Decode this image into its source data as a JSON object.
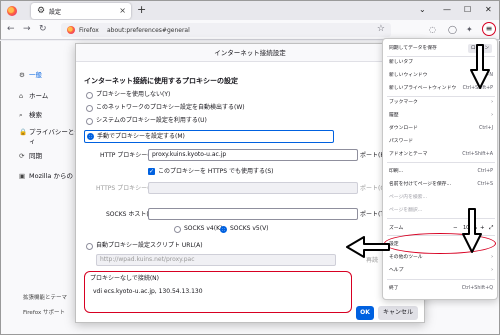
{
  "tab": {
    "title": "設定"
  },
  "urlbar": {
    "brand": "Firefox",
    "url": "about:preferences#general"
  },
  "sidebar": {
    "items": [
      {
        "icon": "gear-icon",
        "label": "一般"
      },
      {
        "icon": "home-icon",
        "label": "ホーム"
      },
      {
        "icon": "search-icon",
        "label": "検索"
      },
      {
        "icon": "lock-icon",
        "label": "プライバシーとセ"
      },
      {
        "icon": "lock-icon",
        "label": "ィ"
      },
      {
        "icon": "sync-icon",
        "label": "同期"
      },
      {
        "icon": "mozilla-icon",
        "label": "Mozilla からの"
      }
    ],
    "footer": [
      "拡張機能とテーマ",
      "Firefox サポート"
    ]
  },
  "dialog": {
    "title": "インターネット接続設定",
    "heading": "インターネット接続に使用するプロキシーの設定",
    "options": [
      "プロキシーを使用しない(Y)",
      "このネットワークのプロキシー設定を自動検出する(W)",
      "システムのプロキシー設定を利用する(U)",
      "手動でプロキシーを設定する(M)"
    ],
    "http_label": "HTTP プロキシー(X)",
    "http_value": "proxy.kuins.kyoto-u.ac.jp",
    "port_label": "ポート(P)",
    "https_check": "このプロキシーを HTTPS でも使用する(S)",
    "https_label": "HTTPS プロキシー(H)",
    "https_port_label": "ポート(O)",
    "socks_label": "SOCKS ホスト(C)",
    "socks_port_label": "ポート(T)",
    "socks_v4": "SOCKS v4(K)",
    "socks_v5": "SOCKS v5(V)",
    "pac_label": "自動プロキシー設定スクリプト URL(A)",
    "pac_value": "http://wpad.kuins.net/proxy.pac",
    "pac_button": "再読",
    "noproxy_label": "プロキシーなしで接続(N)",
    "noproxy_value": "vdi ecs.kyoto-u.ac.jp, 130.54.13.130",
    "ok": "OK",
    "cancel": "キャンセル"
  },
  "menu": {
    "sync_row": "同期してデータを保存",
    "sync_button": "ログイン",
    "items": [
      {
        "label": "新しいタブ",
        "shortcut": ""
      },
      {
        "label": "新しいウィンドウ",
        "shortcut": "Ctrl+N"
      },
      {
        "label": "新しいプライベートウィンドウ",
        "shortcut": "Ctrl+Shift+P"
      },
      {
        "label": "ブックマーク",
        "shortcut": ""
      },
      {
        "label": "履歴",
        "shortcut": ""
      },
      {
        "label": "ダウンロード",
        "shortcut": "Ctrl+J"
      },
      {
        "label": "パスワード",
        "shortcut": ""
      },
      {
        "label": "アドオンとテーマ",
        "shortcut": "Ctrl+Shift+A"
      },
      {
        "label": "印刷...",
        "shortcut": "Ctrl+P"
      },
      {
        "label": "名前を付けてページを保存...",
        "shortcut": "Ctrl+S"
      },
      {
        "label": "ページ内を検索...",
        "shortcut": ""
      },
      {
        "label": "ページを翻訳...",
        "shortcut": ""
      },
      {
        "label": "ズーム",
        "shortcut": ""
      },
      {
        "label": "設定",
        "shortcut": ""
      },
      {
        "label": "その他のツール",
        "shortcut": ""
      },
      {
        "label": "ヘルプ",
        "shortcut": ""
      },
      {
        "label": "終了",
        "shortcut": "Ctrl+Shift+Q"
      }
    ],
    "zoom": {
      "minus": "−",
      "value": "100%",
      "plus": "+"
    }
  },
  "colors": {
    "accent": "#0061e0",
    "annotation": "#d70022"
  }
}
